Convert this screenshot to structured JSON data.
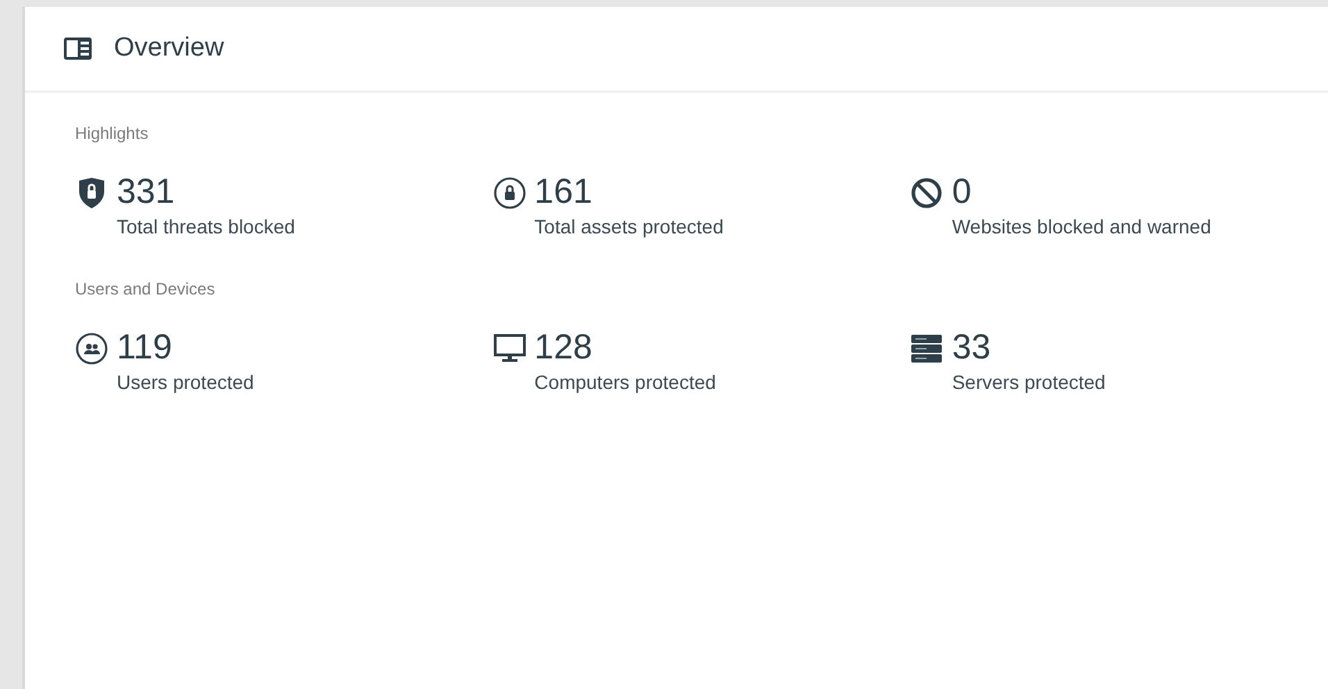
{
  "panel": {
    "title": "Overview"
  },
  "sections": [
    {
      "heading": "Highlights",
      "stats": [
        {
          "value": "331",
          "label": "Total threats blocked"
        },
        {
          "value": "161",
          "label": "Total assets protected"
        },
        {
          "value": "0",
          "label": "Websites blocked and warned"
        }
      ]
    },
    {
      "heading": "Users and Devices",
      "stats": [
        {
          "value": "119",
          "label": "Users protected"
        },
        {
          "value": "128",
          "label": "Computers protected"
        },
        {
          "value": "33",
          "label": "Servers protected"
        }
      ]
    }
  ]
}
